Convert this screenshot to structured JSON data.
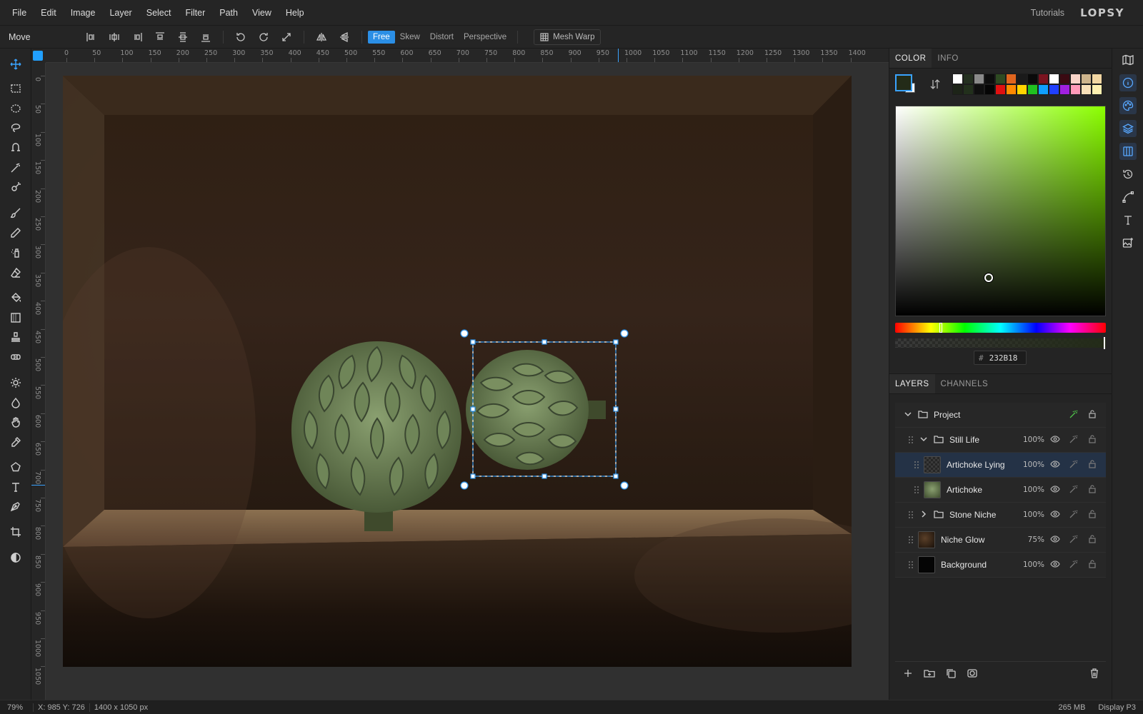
{
  "menu": [
    "File",
    "Edit",
    "Image",
    "Layer",
    "Select",
    "Filter",
    "Path",
    "View",
    "Help"
  ],
  "header": {
    "tutorials": "Tutorials",
    "logo": "LOPSY"
  },
  "options": {
    "tool_name": "Move",
    "transform_modes": [
      "Free",
      "Skew",
      "Distort",
      "Perspective"
    ],
    "active_mode": "Free",
    "mesh_warp": "Mesh Warp"
  },
  "tools": [
    "move-icon",
    "rect-select-icon",
    "ellipse-select-icon",
    "lasso-icon",
    "magnetic-lasso-icon",
    "magic-wand-icon",
    "quick-select-icon",
    "brush-icon",
    "pencil-icon",
    "spray-icon",
    "eraser-icon",
    "bucket-icon",
    "gradient-icon",
    "stamp-icon",
    "healing-icon",
    "dodge-icon",
    "blur-icon",
    "hand-icon",
    "eyedropper-icon",
    "polygon-icon",
    "text-icon",
    "pen-icon",
    "crop-icon",
    "contrast-icon"
  ],
  "ruler": {
    "h": [
      "0",
      "50",
      "100",
      "150",
      "200",
      "250",
      "300",
      "350",
      "400",
      "450",
      "500",
      "550",
      "600",
      "650",
      "700",
      "750",
      "800",
      "850",
      "900",
      "950",
      "1000",
      "1050",
      "1100",
      "1150",
      "1200",
      "1250",
      "1300",
      "1350",
      "1400"
    ],
    "v": [
      "0",
      "50",
      "100",
      "150",
      "200",
      "250",
      "300",
      "350",
      "400",
      "450",
      "500",
      "550",
      "600",
      "650",
      "700",
      "750",
      "800",
      "850",
      "900",
      "950",
      "1000",
      "1050"
    ]
  },
  "color_panel": {
    "tabs": [
      "COLOR",
      "INFO"
    ],
    "active_tab": "COLOR",
    "foreground": "#232b18",
    "background": "#ffffff",
    "hex": "232B18",
    "hash": "#",
    "presets": [
      "#ffffff",
      "#243020",
      "#8a8a8a",
      "#0d0d0d",
      "#2e4a22",
      "#e0651e",
      "#1a1a1a",
      "#0a0a0a",
      "#7a1420",
      "#ffffff",
      "#3a0a12",
      "#f8d4c8",
      "#cdb48c",
      "#f2d6a2",
      "#1d2418",
      "#22301c",
      "#0f0f0f",
      "#050505",
      "#e01010",
      "#ff8a00",
      "#ffd400",
      "#20c020",
      "#10a0ff",
      "#2040ff",
      "#a020e0",
      "#ff9ab8",
      "#f8e0b8",
      "#fff0b0"
    ]
  },
  "layers_panel": {
    "tabs": [
      "LAYERS",
      "CHANNELS"
    ],
    "active_tab": "LAYERS",
    "layers": [
      {
        "name": "Project",
        "opacity": "",
        "type": "group",
        "depth": 0,
        "expanded": true
      },
      {
        "name": "Still Life",
        "opacity": "100%",
        "type": "group",
        "depth": 1,
        "expanded": true
      },
      {
        "name": "Artichoke Lying",
        "opacity": "100%",
        "type": "layer",
        "depth": 2,
        "selected": true
      },
      {
        "name": "Artichoke",
        "opacity": "100%",
        "type": "layer",
        "depth": 2
      },
      {
        "name": "Stone Niche",
        "opacity": "100%",
        "type": "group",
        "depth": 1,
        "expanded": false
      },
      {
        "name": "Niche Glow",
        "opacity": "75%",
        "type": "layer",
        "depth": 1
      },
      {
        "name": "Background",
        "opacity": "100%",
        "type": "layer",
        "depth": 1
      }
    ]
  },
  "status": {
    "zoom": "79%",
    "coords": "X: 985  Y: 726",
    "dims": "1400 x 1050",
    "unit": "px",
    "memory": "265 MB",
    "profile": "Display P3"
  },
  "rail_icons": [
    "map-icon",
    "info-icon",
    "palette-icon",
    "layers-icon",
    "channels-icon",
    "history-icon",
    "path-icon",
    "type-icon",
    "image-adjust-icon"
  ]
}
